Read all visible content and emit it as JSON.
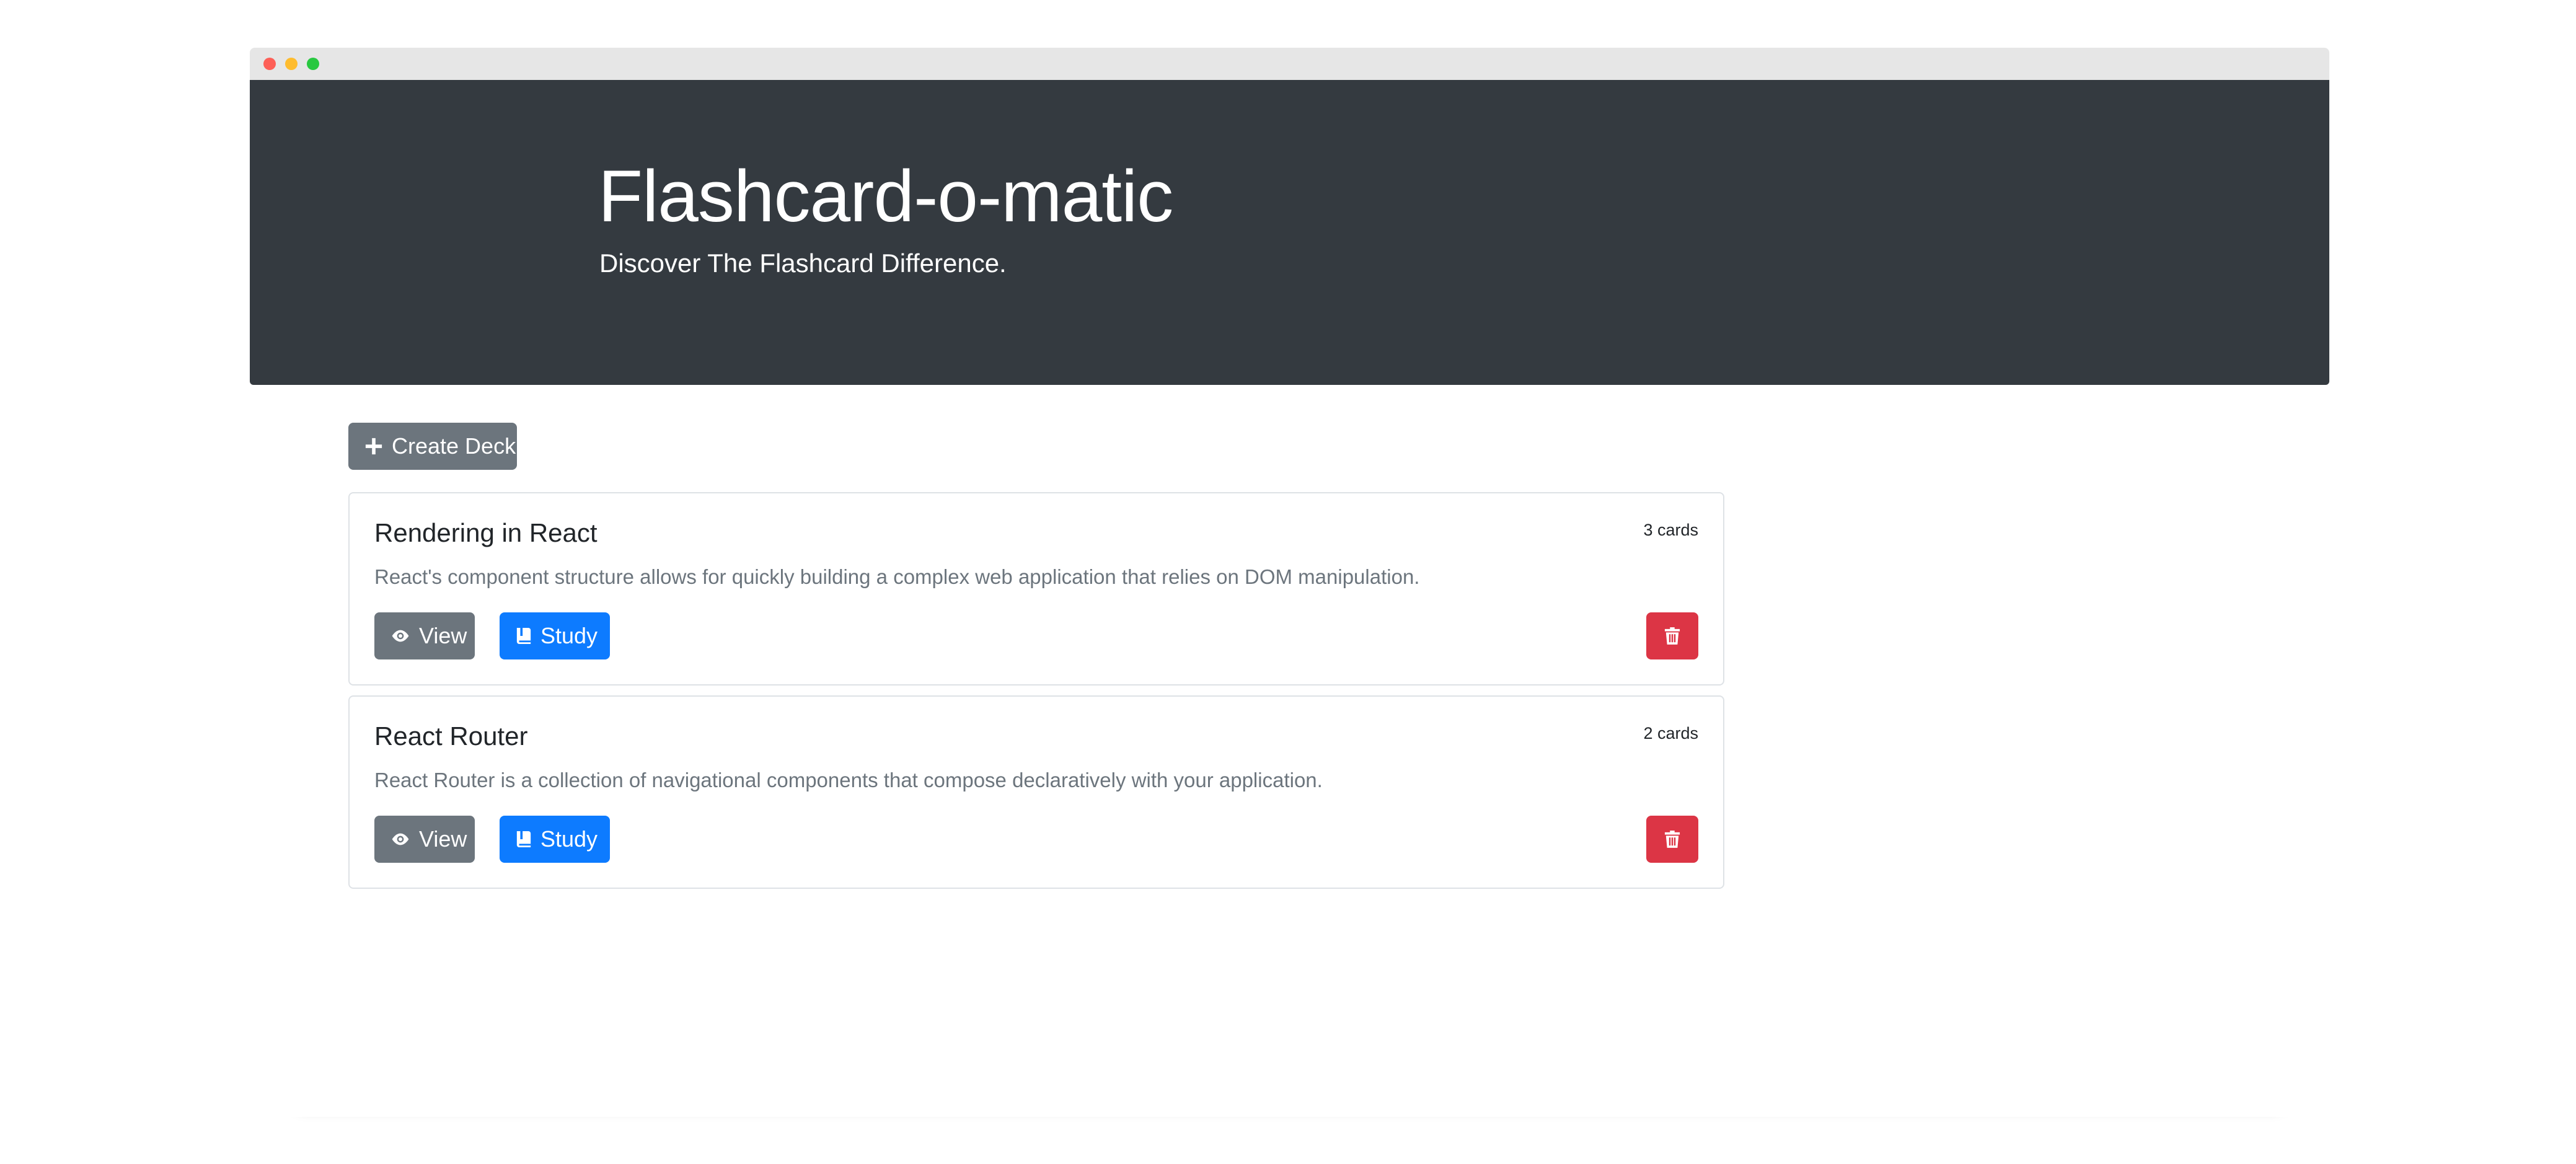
{
  "window": {
    "controls": [
      "close",
      "minimize",
      "zoom"
    ]
  },
  "header": {
    "title": "Flashcard-o-matic",
    "subtitle": "Discover The Flashcard Difference.",
    "background_color": "#343a40"
  },
  "toolbar": {
    "create_deck_label": "Create Deck",
    "create_deck_icon": "plus-icon"
  },
  "decks": [
    {
      "name": "Rendering in React",
      "count": "3 cards",
      "description": "React's component structure allows for quickly building a complex web application that relies on DOM manipulation.",
      "view_label": "View",
      "study_label": "Study"
    },
    {
      "name": "React Router",
      "count": "2 cards",
      "description": "React Router is a collection of navigational components that compose declaratively with your application.",
      "view_label": "View",
      "study_label": "Study"
    }
  ],
  "colors": {
    "secondary": "#6c757d",
    "primary": "#0d7bff",
    "danger": "#dc3545"
  }
}
